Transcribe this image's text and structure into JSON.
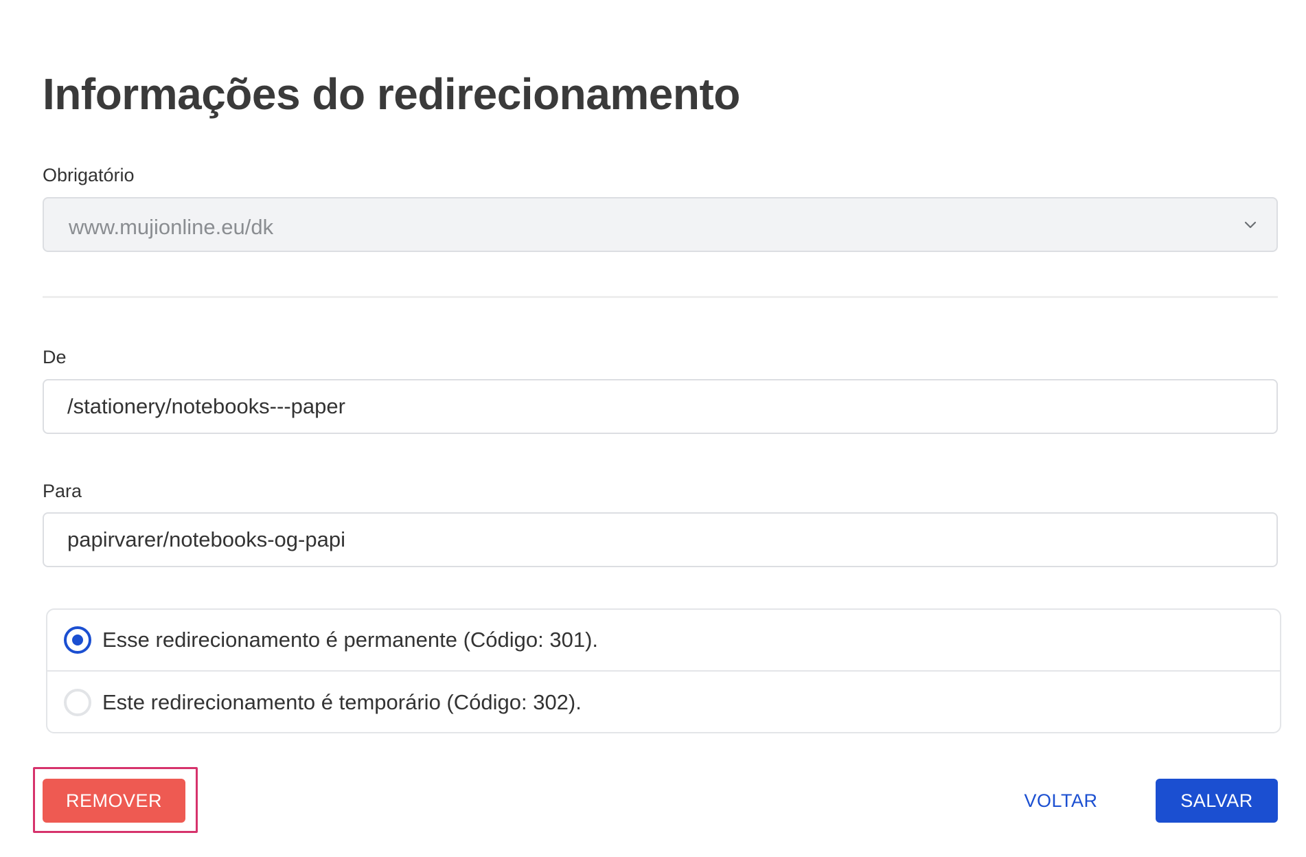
{
  "page": {
    "title": "Informações do redirecionamento"
  },
  "domain_field": {
    "label": "Obrigatório",
    "value": "www.mujionline.eu/dk",
    "icon": "chevron-down-icon"
  },
  "from_field": {
    "label": "De",
    "value": "/stationery/notebooks---paper"
  },
  "to_field": {
    "label": "Para",
    "value": "papirvarer/notebooks-og-papi"
  },
  "redirect_type": {
    "options": [
      {
        "label": "Esse redirecionamento é permanente (Código: 301).",
        "selected": true
      },
      {
        "label": "Este redirecionamento é temporário (Código: 302).",
        "selected": false
      }
    ]
  },
  "actions": {
    "remove_label": "REMOVER",
    "back_label": "VOLTAR",
    "save_label": "SALVAR"
  },
  "colors": {
    "primary": "#1b4fd1",
    "danger": "#ee5a52",
    "highlight": "#d6336c"
  }
}
